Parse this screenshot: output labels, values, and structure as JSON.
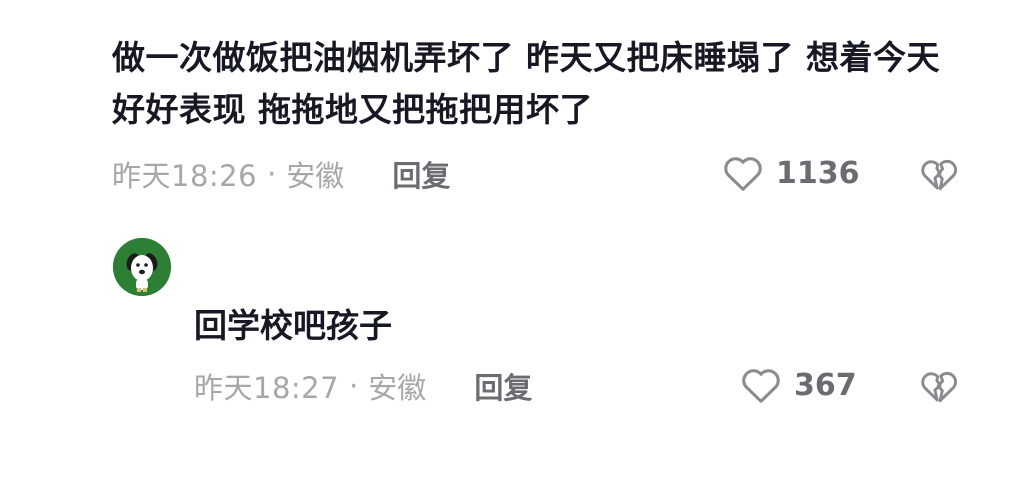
{
  "comment": {
    "text": "做一次做饭把油烟机弄坏了 昨天又把床睡塌了 想着今天好好表现 拖拖地又把拖把用坏了",
    "time": "昨天18:26",
    "separator": "·",
    "location": "安徽",
    "reply_label": "回复",
    "likes": "1136",
    "like_icon": "heart-outline-icon",
    "dislike_icon": "broken-heart-icon"
  },
  "reply": {
    "avatar_icon": "cartoon-dog-avatar",
    "avatar_color": "#2e7f36",
    "text": "回学校吧孩子",
    "time": "昨天18:27",
    "separator": "·",
    "location": "安徽",
    "reply_label": "回复",
    "likes": "367",
    "like_icon": "heart-outline-icon",
    "dislike_icon": "broken-heart-icon"
  },
  "colors": {
    "text_primary": "#161823",
    "text_meta": "#a6a7ab",
    "text_action": "#6b6c71",
    "background": "#ffffff"
  }
}
